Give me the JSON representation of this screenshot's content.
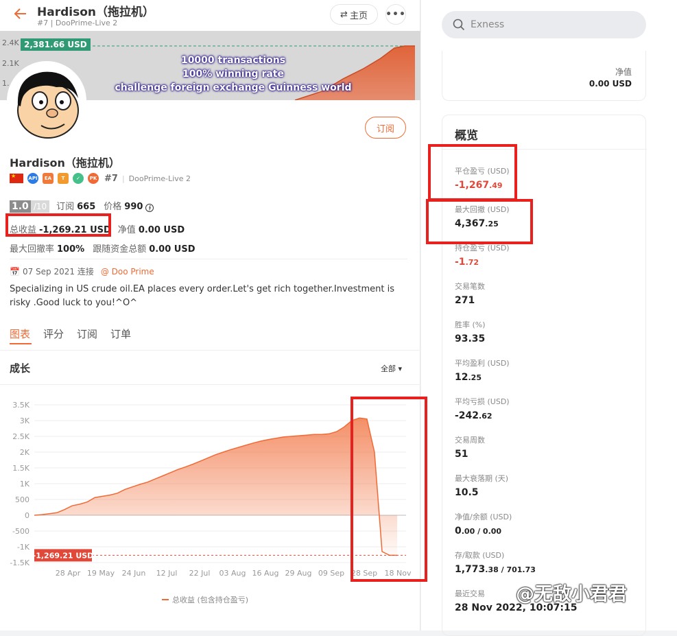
{
  "header": {
    "title": "Hardison（拖拉机）",
    "subtitle": "#7 | DooPrime-Live 2",
    "home_label": "主页"
  },
  "banner": {
    "tag": "2,381.66 USD",
    "yticks": [
      "2.4K",
      "2.1K",
      "1."
    ],
    "lines": [
      "10000 transactions",
      "100% winning rate",
      "challenge foreign exchange Guinness world"
    ]
  },
  "profile": {
    "subscribe_label": "订阅",
    "name": "Hardison（拖拉机）",
    "rank": "#7",
    "server": "DooPrime-Live 2",
    "badges": [
      "API",
      "EA",
      "T",
      "✓",
      "PK"
    ],
    "score": "1.0",
    "score_max": "/10",
    "subs_label": "订阅",
    "subs_value": "665",
    "price_label": "价格",
    "price_value": "990",
    "total_profit_label": "总收益",
    "total_profit_value": "-1,269.21 USD",
    "equity_label": "净值",
    "equity_value": "0.00 USD",
    "max_dd_label": "最大回撤率",
    "max_dd_value": "100%",
    "follow_label": "跟随资金总额",
    "follow_value": "0.00 USD",
    "join_date": "07 Sep 2021 连接",
    "broker": "@ Doo Prime",
    "description": "Specializing in US crude oil.EA places every order.Let's get rich together.Investment is risky .Good luck to you!^O^"
  },
  "tabs": [
    "图表",
    "评分",
    "订阅",
    "订单"
  ],
  "growth": {
    "title": "成长",
    "filter": "全部",
    "legend": "总收益 (包含持仓盈亏)"
  },
  "chart_data": {
    "type": "area",
    "y_ticks": [
      "3.5K",
      "3K",
      "2.5K",
      "2K",
      "1.5K",
      "1K",
      "500",
      "0",
      "-500",
      "-1K",
      "-1.5K"
    ],
    "x_ticks": [
      "28 Apr",
      "19 May",
      "24 Jun",
      "12 Jul",
      "22 Jul",
      "03 Aug",
      "16 Aug",
      "29 Aug",
      "09 Sep",
      "28 Sep",
      "18 Nov"
    ],
    "ylim": [
      -1500,
      3500
    ],
    "last_value_tag": "-1,269.21 USD",
    "color": "#f06a35",
    "series": [
      {
        "values": [
          0,
          20,
          50,
          80,
          180,
          300,
          350,
          420,
          560,
          600,
          640,
          700,
          820,
          900,
          980,
          1050,
          1150,
          1250,
          1350,
          1450,
          1530,
          1620,
          1720,
          1820,
          1920,
          2000,
          2080,
          2150,
          2220,
          2290,
          2350,
          2400,
          2440,
          2480,
          2500,
          2520,
          2540,
          2560,
          2560,
          2580,
          2650,
          2800,
          3000,
          3080,
          3050,
          2000,
          -1150,
          -1269.21,
          -1269.21
        ]
      }
    ]
  },
  "search": {
    "placeholder": "Exness"
  },
  "top_card": {
    "label": "净值",
    "value": "0.00 USD"
  },
  "overview": {
    "title": "概览",
    "items": [
      {
        "label": "平仓盈亏 (USD)",
        "main": "-1,267",
        "dec": ".49",
        "red": true
      },
      {
        "label": "最大回撤 (USD)",
        "main": "4,367",
        "dec": ".25",
        "red": false
      },
      {
        "label": "持仓盈亏 (USD)",
        "main": "-1",
        "dec": ".72",
        "red": true
      },
      {
        "label": "交易笔数",
        "main": "271",
        "dec": "",
        "red": false
      },
      {
        "label": "胜率 (%)",
        "main": "93.35",
        "dec": "",
        "red": false
      },
      {
        "label": "平均盈利 (USD)",
        "main": "12",
        "dec": ".25",
        "red": false
      },
      {
        "label": "平均亏损 (USD)",
        "main": "-242",
        "dec": ".62",
        "red": false
      },
      {
        "label": "交易周数",
        "main": "51",
        "dec": "",
        "red": false
      },
      {
        "label": "最大衰落期 (天)",
        "main": "10.5",
        "dec": "",
        "red": false
      },
      {
        "label": "净值/余额 (USD)",
        "main": "0",
        "dec": ".00 / 0.00",
        "red": false
      },
      {
        "label": "存/取款 (USD)",
        "main": "1,773",
        "dec": ".38 / 701.73",
        "red": false
      },
      {
        "label": "最近交易",
        "main": "28 Nov 2022, 10:07:15",
        "dec": "",
        "red": false
      }
    ]
  },
  "watermark": "@无敌小君君"
}
